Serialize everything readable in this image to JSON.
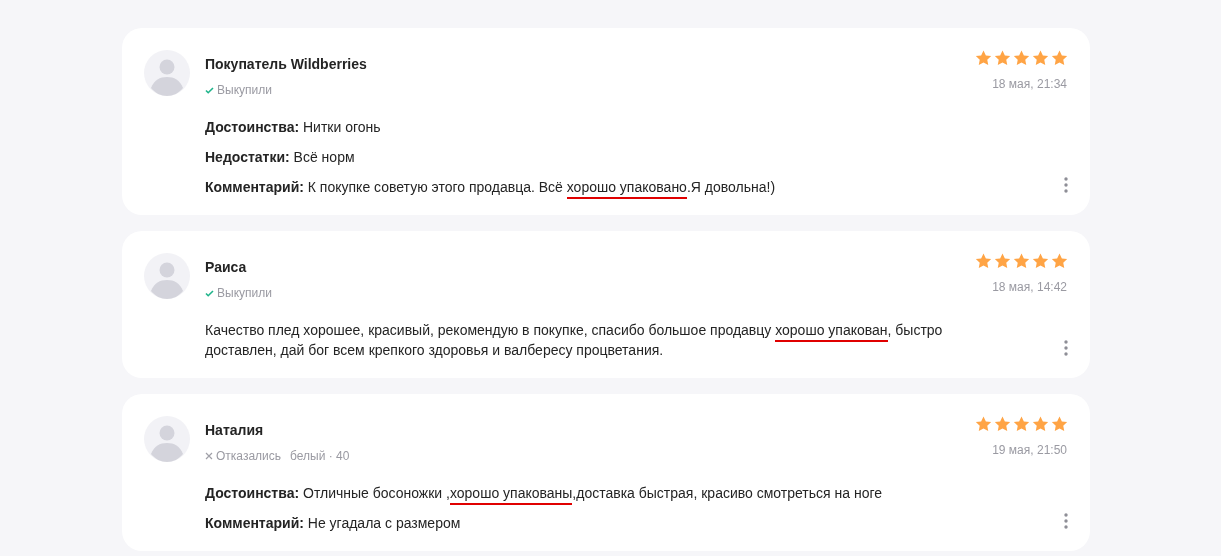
{
  "reviews": [
    {
      "author": "Покупатель Wildberries",
      "status": {
        "kind": "bought",
        "text": "Выкупили"
      },
      "stars": 5,
      "date": "18 мая, 21:34",
      "paragraphs": [
        {
          "label": "Достоинства:",
          "parts": [
            {
              "text": "Нитки огонь",
              "underlined": false
            }
          ]
        },
        {
          "label": "Недостатки:",
          "parts": [
            {
              "text": "Всё норм",
              "underlined": false
            }
          ]
        },
        {
          "label": "Комментарий:",
          "parts": [
            {
              "text": "К покупке советую этого продавца. Всё ",
              "underlined": false
            },
            {
              "text": "хорошо упаковано",
              "underlined": true
            },
            {
              "text": ".Я довольна!)",
              "underlined": false
            }
          ]
        }
      ]
    },
    {
      "author": "Раиса",
      "status": {
        "kind": "bought",
        "text": "Выкупили"
      },
      "stars": 5,
      "date": "18 мая, 14:42",
      "paragraphs": [
        {
          "parts": [
            {
              "text": "Качество плед хорошее, красивый, рекомендую в покупке, спасибо большое продавцу ",
              "underlined": false
            },
            {
              "text": "хорошо упакован",
              "underlined": true
            },
            {
              "text": ", быстро доставлен, дай бог всем крепкого здоровья и валбересу процветания.",
              "underlined": false
            }
          ]
        }
      ]
    },
    {
      "author": "Наталия",
      "status": {
        "kind": "refused",
        "text": "Отказались"
      },
      "variant": "белый · 40",
      "stars": 5,
      "date": "19 мая, 21:50",
      "paragraphs": [
        {
          "label": "Достоинства:",
          "parts": [
            {
              "text": "Отличные босоножки ,",
              "underlined": false
            },
            {
              "text": "хорошо упакованы",
              "underlined": true
            },
            {
              "text": ",доставка быстрая, красиво смотреться на ноге",
              "underlined": false
            }
          ]
        },
        {
          "label": "Комментарий:",
          "parts": [
            {
              "text": "Не угадала с размером",
              "underlined": false
            }
          ]
        }
      ]
    }
  ]
}
